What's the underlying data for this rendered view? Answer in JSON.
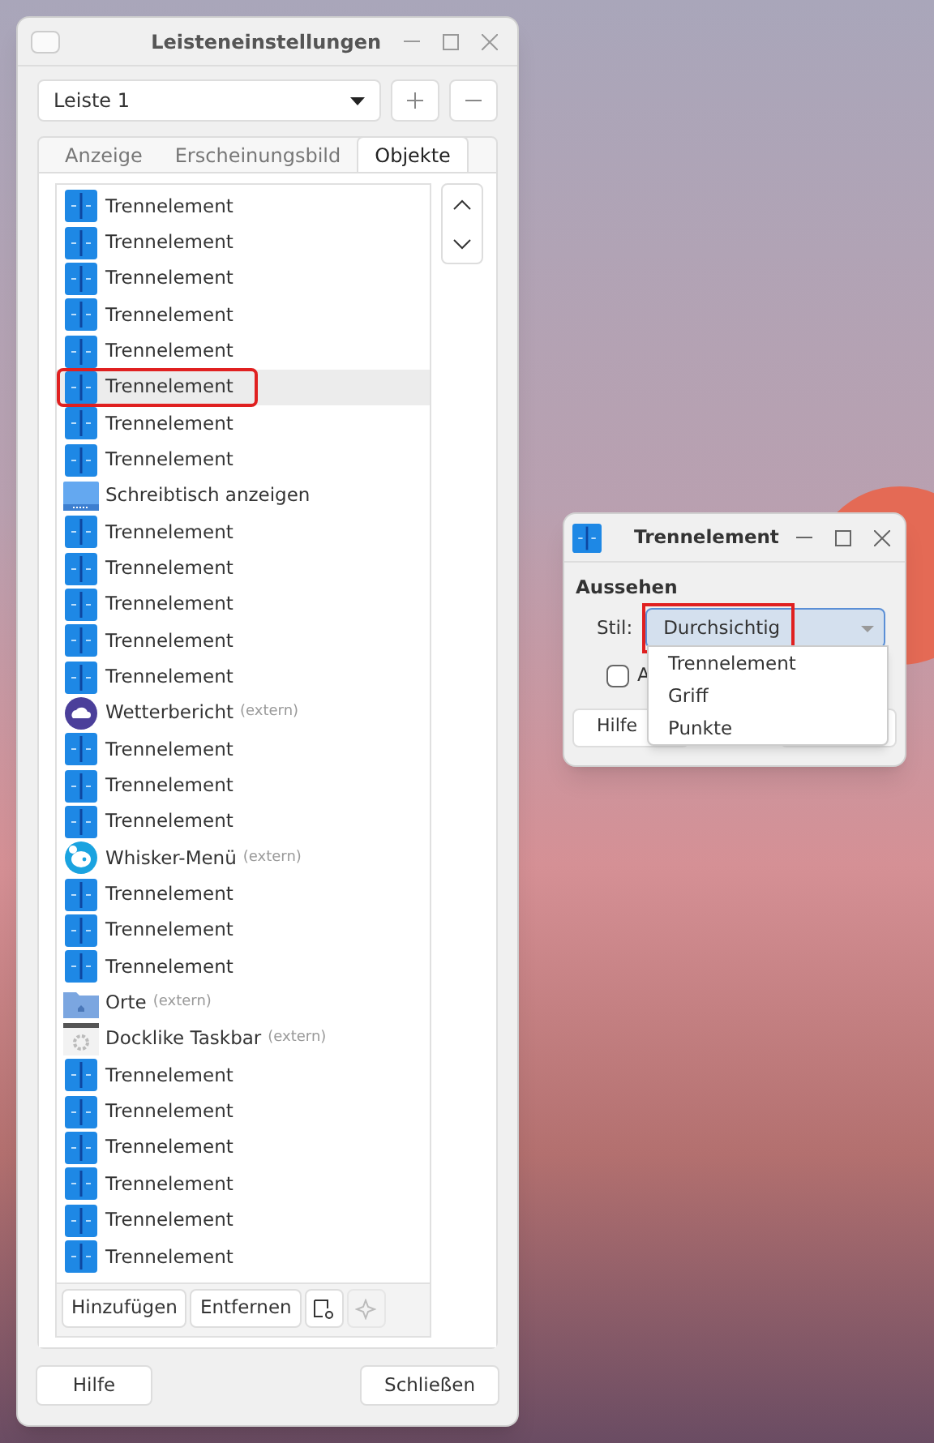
{
  "window": {
    "title": "Leisteneinstellungen"
  },
  "panel_select": {
    "value": "Leiste 1"
  },
  "tabs": [
    {
      "label": "Anzeige",
      "selected": false
    },
    {
      "label": "Erscheinungsbild",
      "selected": false
    },
    {
      "label": "Objekte",
      "selected": true
    }
  ],
  "items": [
    {
      "kind": "separator",
      "label": "Trennelement",
      "selected": false
    },
    {
      "kind": "separator",
      "label": "Trennelement",
      "selected": false
    },
    {
      "kind": "separator",
      "label": "Trennelement",
      "selected": false
    },
    {
      "kind": "separator",
      "label": "Trennelement",
      "selected": false
    },
    {
      "kind": "separator",
      "label": "Trennelement",
      "selected": false
    },
    {
      "kind": "separator",
      "label": "Trennelement",
      "selected": true,
      "highlighted": true
    },
    {
      "kind": "separator",
      "label": "Trennelement",
      "selected": false
    },
    {
      "kind": "separator",
      "label": "Trennelement",
      "selected": false
    },
    {
      "kind": "desktop",
      "label": "Schreibtisch anzeigen",
      "selected": false
    },
    {
      "kind": "separator",
      "label": "Trennelement",
      "selected": false
    },
    {
      "kind": "separator",
      "label": "Trennelement",
      "selected": false
    },
    {
      "kind": "separator",
      "label": "Trennelement",
      "selected": false
    },
    {
      "kind": "separator",
      "label": "Trennelement",
      "selected": false
    },
    {
      "kind": "separator",
      "label": "Trennelement",
      "selected": false
    },
    {
      "kind": "weather",
      "label": "Wetterbericht",
      "note": "(extern)",
      "selected": false
    },
    {
      "kind": "separator",
      "label": "Trennelement",
      "selected": false
    },
    {
      "kind": "separator",
      "label": "Trennelement",
      "selected": false
    },
    {
      "kind": "separator",
      "label": "Trennelement",
      "selected": false
    },
    {
      "kind": "whisker",
      "label": "Whisker-Menü",
      "note": "(extern)",
      "selected": false
    },
    {
      "kind": "separator",
      "label": "Trennelement",
      "selected": false
    },
    {
      "kind": "separator",
      "label": "Trennelement",
      "selected": false
    },
    {
      "kind": "separator",
      "label": "Trennelement",
      "selected": false
    },
    {
      "kind": "places",
      "label": "Orte",
      "note": "(extern)",
      "selected": false
    },
    {
      "kind": "docklike",
      "label": "Docklike Taskbar",
      "note": "(extern)",
      "selected": false
    },
    {
      "kind": "separator",
      "label": "Trennelement",
      "selected": false
    },
    {
      "kind": "separator",
      "label": "Trennelement",
      "selected": false
    },
    {
      "kind": "separator",
      "label": "Trennelement",
      "selected": false
    },
    {
      "kind": "separator",
      "label": "Trennelement",
      "selected": false
    },
    {
      "kind": "separator",
      "label": "Trennelement",
      "selected": false
    },
    {
      "kind": "separator",
      "label": "Trennelement",
      "selected": false
    }
  ],
  "list_buttons": [
    "Hinzufügen",
    "Entfernen"
  ],
  "footer_buttons": [
    "Hilfe",
    "Schließen"
  ],
  "dialog": {
    "title": "Trennelement",
    "section": "Aussehen",
    "style_label": "Stil:",
    "style_value": "Durchsichtig",
    "style_highlighted": true,
    "options": [
      "Trennelement",
      "Griff",
      "Punkte"
    ],
    "expand": {
      "label": "A",
      "checked": false
    },
    "buttons": [
      "Hilfe"
    ]
  }
}
